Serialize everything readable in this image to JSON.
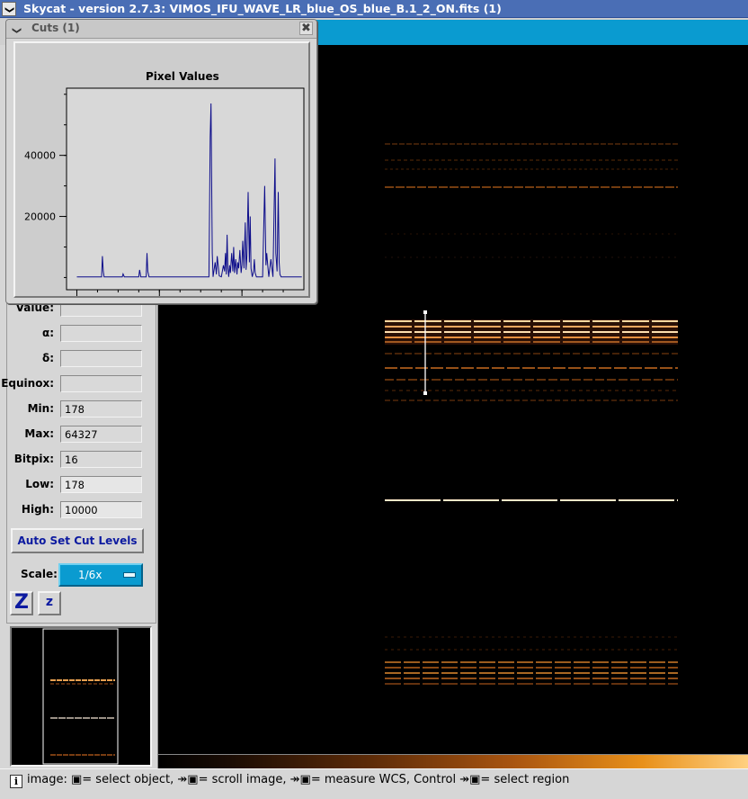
{
  "window": {
    "title": "Skycat - version 2.7.3: VIMOS_IFU_WAVE_LR_blue_OS_blue_B.1_2_ON.fits (1)",
    "menu_glyph": "❯"
  },
  "cuts_dialog": {
    "title": "Cuts (1)",
    "close_glyph": "✖",
    "plot_title": "Pixel Values",
    "line_color": "#0c0c8a",
    "chart_data": {
      "type": "line",
      "title": "Pixel Values",
      "xlabel": "",
      "ylabel": "",
      "xlim": [
        -25,
        550
      ],
      "ylim": [
        -4000,
        62000
      ],
      "xticks": [
        0,
        200,
        400
      ],
      "yticks": [
        20000,
        40000
      ],
      "x": [
        0,
        60,
        62,
        64,
        66,
        70,
        110,
        112,
        115,
        150,
        152,
        155,
        168,
        170,
        172,
        175,
        320,
        323,
        325,
        328,
        330,
        335,
        338,
        340,
        345,
        350,
        355,
        358,
        360,
        362,
        364,
        366,
        368,
        370,
        372,
        375,
        378,
        380,
        382,
        385,
        388,
        390,
        392,
        395,
        398,
        400,
        402,
        405,
        408,
        410,
        412,
        415,
        418,
        420,
        422,
        425,
        428,
        430,
        432,
        435,
        440,
        450,
        455,
        458,
        460,
        463,
        465,
        470,
        475,
        480,
        482,
        485,
        488,
        490,
        492,
        495,
        500,
        510,
        520,
        545
      ],
      "y": [
        200,
        200,
        7000,
        2000,
        200,
        200,
        200,
        1200,
        200,
        200,
        2500,
        200,
        200,
        8000,
        2000,
        200,
        200,
        46000,
        57000,
        8000,
        200,
        5000,
        1000,
        7000,
        500,
        200,
        4000,
        2000,
        8000,
        1000,
        14000,
        3000,
        200,
        4000,
        1500,
        8000,
        2000,
        10000,
        1500,
        6000,
        1000,
        5000,
        3000,
        9000,
        1500,
        4000,
        12000,
        3000,
        18000,
        2500,
        7000,
        28000,
        5000,
        20000,
        3000,
        200,
        2000,
        6000,
        1500,
        200,
        200,
        200,
        30000,
        4000,
        8000,
        3000,
        200,
        6000,
        200,
        39000,
        8000,
        2000,
        28000,
        5000,
        1000,
        200,
        200,
        200,
        200,
        200
      ]
    }
  },
  "panel": {
    "fields": [
      {
        "label": "Value:",
        "value": ""
      },
      {
        "label": "α:",
        "value": ""
      },
      {
        "label": "δ:",
        "value": ""
      },
      {
        "label": "Equinox:",
        "value": ""
      },
      {
        "label": "Min:",
        "value": "178"
      },
      {
        "label": "Max:",
        "value": "64327"
      },
      {
        "label": "Bitpix:",
        "value": "16"
      },
      {
        "label": "Low:",
        "value": "178"
      },
      {
        "label": "High:",
        "value": "10000"
      }
    ],
    "auto_button": "Auto Set Cut Levels",
    "scale_label": "Scale:",
    "scale_value": "1/6x",
    "zoom_in": "Z",
    "zoom_out": "z"
  },
  "status": {
    "icon": "i",
    "text": "image: ▣= select object, ↠▣= scroll image, ↠▣= measure WCS, Control ↠▣= select region"
  },
  "colors": {
    "accent": "#0a9bd0",
    "title_bar": "#4a6eb5",
    "spectrum_bright": "#ffd8a0",
    "spectrum_dim": "#b85c18"
  }
}
